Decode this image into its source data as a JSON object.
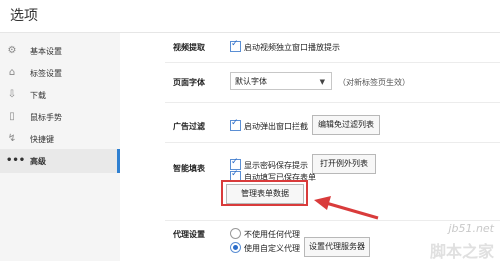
{
  "window": {
    "title": "选项"
  },
  "sidebar": {
    "items": [
      {
        "label": "基本设置",
        "icon": "gear-icon"
      },
      {
        "label": "标签设置",
        "icon": "tab-icon"
      },
      {
        "label": "下载",
        "icon": "download-icon"
      },
      {
        "label": "鼠标手势",
        "icon": "mouse-icon"
      },
      {
        "label": "快捷键",
        "icon": "lightning-icon"
      },
      {
        "label": "高级",
        "icon": "more-dots-icon",
        "active": true
      }
    ]
  },
  "sections": {
    "video": {
      "label": "视频提取",
      "checkbox_label": "启动视频独立窗口播放提示",
      "checked": true
    },
    "font": {
      "label": "页面字体",
      "selected_value": "默认字体",
      "note": "（对新标签页生效）"
    },
    "ad_filter": {
      "label": "广告过滤",
      "checkbox_label": "启动弹出窗口拦截",
      "checked": true,
      "button_label": "编辑免过滤列表"
    },
    "smart_form": {
      "label": "智能填表",
      "checkbox1_label": "显示密码保存提示",
      "checkbox1_checked": true,
      "button1_label": "打开例外列表",
      "checkbox2_label": "自动填写已保存表单",
      "checkbox2_checked": true,
      "manage_button_label": "管理表单数据"
    },
    "proxy": {
      "label": "代理设置",
      "option1_label": "不使用任何代理",
      "option1_selected": false,
      "option2_label": "使用自定义代理",
      "option2_selected": true,
      "button_label": "设置代理服务器"
    }
  },
  "annotation": {
    "highlight_color": "#d93b3b"
  },
  "watermark": {
    "line1": "jb51.net",
    "line2": "脚本之家"
  }
}
